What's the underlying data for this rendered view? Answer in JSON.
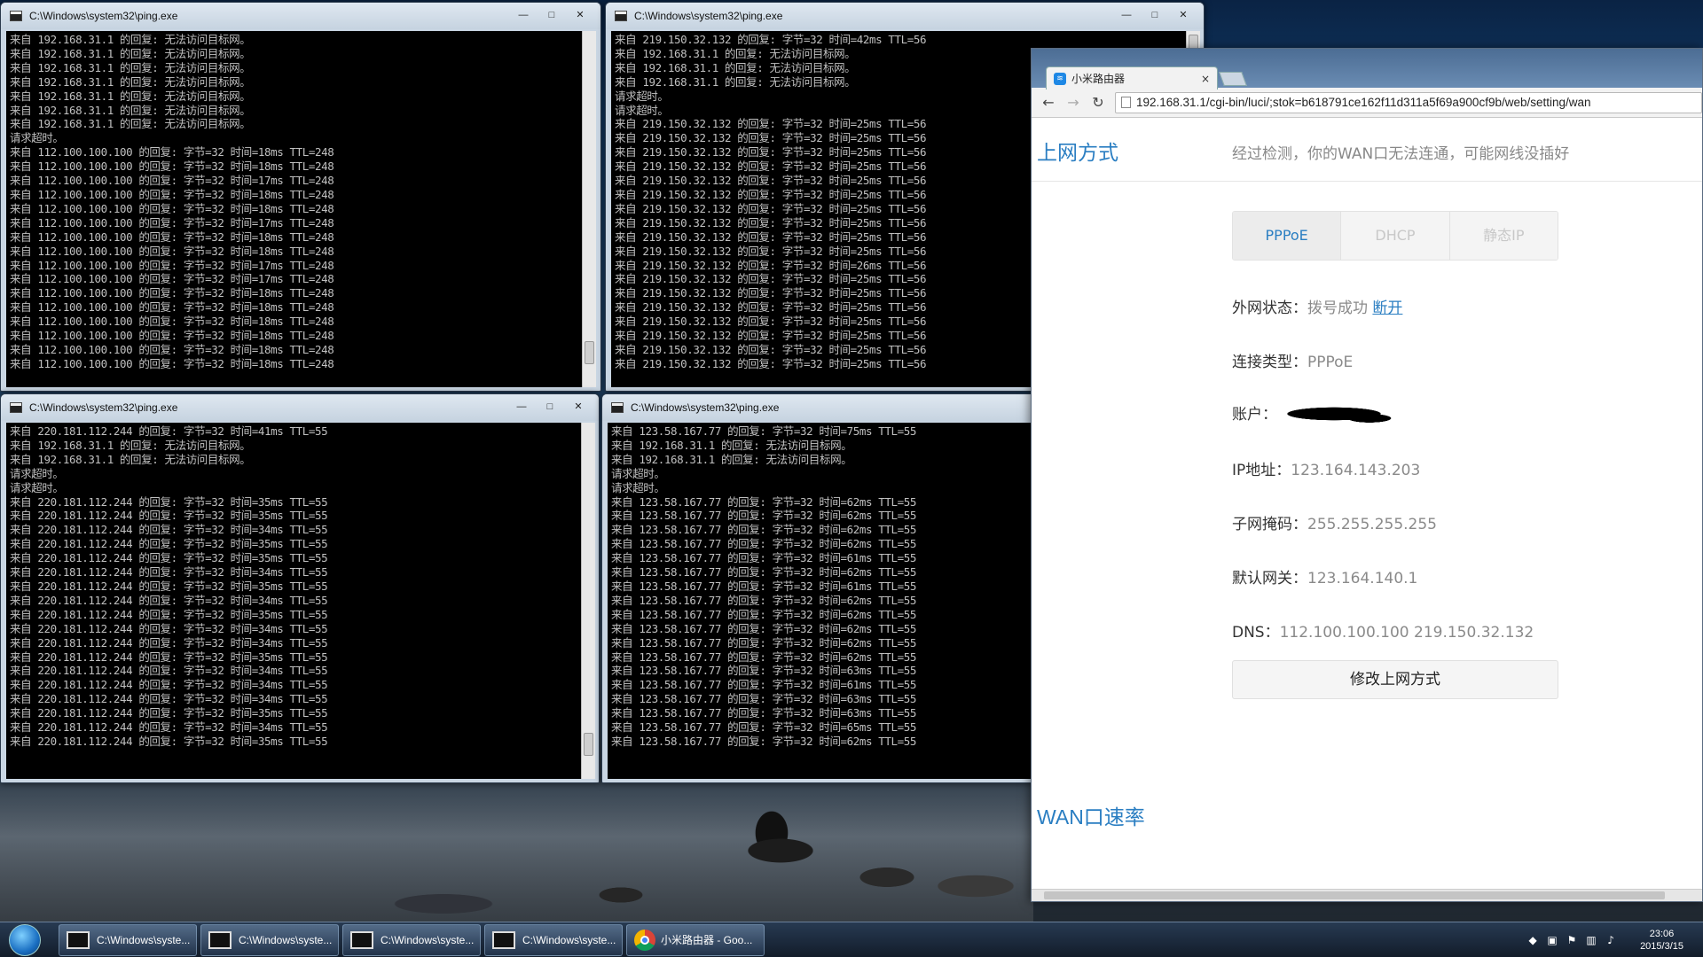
{
  "cmd_title": "C:\\Windows\\system32\\ping.exe",
  "window_controls": {
    "minimize": "—",
    "maximize": "□",
    "close": "✕"
  },
  "consoles": [
    {
      "id": "top-left",
      "lines": [
        "来自 192.168.31.1 的回复: 无法访问目标网。",
        "来自 192.168.31.1 的回复: 无法访问目标网。",
        "来自 192.168.31.1 的回复: 无法访问目标网。",
        "来自 192.168.31.1 的回复: 无法访问目标网。",
        "来自 192.168.31.1 的回复: 无法访问目标网。",
        "来自 192.168.31.1 的回复: 无法访问目标网。",
        "来自 192.168.31.1 的回复: 无法访问目标网。",
        "请求超时。",
        "来自 112.100.100.100 的回复: 字节=32 时间=18ms TTL=248",
        "来自 112.100.100.100 的回复: 字节=32 时间=18ms TTL=248",
        "来自 112.100.100.100 的回复: 字节=32 时间=17ms TTL=248",
        "来自 112.100.100.100 的回复: 字节=32 时间=18ms TTL=248",
        "来自 112.100.100.100 的回复: 字节=32 时间=18ms TTL=248",
        "来自 112.100.100.100 的回复: 字节=32 时间=17ms TTL=248",
        "来自 112.100.100.100 的回复: 字节=32 时间=18ms TTL=248",
        "来自 112.100.100.100 的回复: 字节=32 时间=18ms TTL=248",
        "来自 112.100.100.100 的回复: 字节=32 时间=17ms TTL=248",
        "来自 112.100.100.100 的回复: 字节=32 时间=17ms TTL=248",
        "来自 112.100.100.100 的回复: 字节=32 时间=18ms TTL=248",
        "来自 112.100.100.100 的回复: 字节=32 时间=18ms TTL=248",
        "来自 112.100.100.100 的回复: 字节=32 时间=18ms TTL=248",
        "来自 112.100.100.100 的回复: 字节=32 时间=18ms TTL=248",
        "来自 112.100.100.100 的回复: 字节=32 时间=18ms TTL=248",
        "来自 112.100.100.100 的回复: 字节=32 时间=18ms TTL=248"
      ]
    },
    {
      "id": "top-right",
      "lines": [
        "来自 219.150.32.132 的回复: 字节=32 时间=42ms TTL=56",
        "来自 192.168.31.1 的回复: 无法访问目标网。",
        "来自 192.168.31.1 的回复: 无法访问目标网。",
        "来自 192.168.31.1 的回复: 无法访问目标网。",
        "请求超时。",
        "请求超时。",
        "来自 219.150.32.132 的回复: 字节=32 时间=25ms TTL=56",
        "来自 219.150.32.132 的回复: 字节=32 时间=25ms TTL=56",
        "来自 219.150.32.132 的回复: 字节=32 时间=25ms TTL=56",
        "来自 219.150.32.132 的回复: 字节=32 时间=25ms TTL=56",
        "来自 219.150.32.132 的回复: 字节=32 时间=25ms TTL=56",
        "来自 219.150.32.132 的回复: 字节=32 时间=25ms TTL=56",
        "来自 219.150.32.132 的回复: 字节=32 时间=25ms TTL=56",
        "来自 219.150.32.132 的回复: 字节=32 时间=25ms TTL=56",
        "来自 219.150.32.132 的回复: 字节=32 时间=25ms TTL=56",
        "来自 219.150.32.132 的回复: 字节=32 时间=25ms TTL=56",
        "来自 219.150.32.132 的回复: 字节=32 时间=26ms TTL=56",
        "来自 219.150.32.132 的回复: 字节=32 时间=25ms TTL=56",
        "来自 219.150.32.132 的回复: 字节=32 时间=25ms TTL=56",
        "来自 219.150.32.132 的回复: 字节=32 时间=25ms TTL=56",
        "来自 219.150.32.132 的回复: 字节=32 时间=25ms TTL=56",
        "来自 219.150.32.132 的回复: 字节=32 时间=25ms TTL=56",
        "来自 219.150.32.132 的回复: 字节=32 时间=25ms TTL=56",
        "来自 219.150.32.132 的回复: 字节=32 时间=25ms TTL=56"
      ]
    },
    {
      "id": "bottom-left",
      "lines": [
        "来自 220.181.112.244 的回复: 字节=32 时间=41ms TTL=55",
        "来自 192.168.31.1 的回复: 无法访问目标网。",
        "来自 192.168.31.1 的回复: 无法访问目标网。",
        "请求超时。",
        "请求超时。",
        "来自 220.181.112.244 的回复: 字节=32 时间=35ms TTL=55",
        "来自 220.181.112.244 的回复: 字节=32 时间=35ms TTL=55",
        "来自 220.181.112.244 的回复: 字节=32 时间=34ms TTL=55",
        "来自 220.181.112.244 的回复: 字节=32 时间=35ms TTL=55",
        "来自 220.181.112.244 的回复: 字节=32 时间=35ms TTL=55",
        "来自 220.181.112.244 的回复: 字节=32 时间=34ms TTL=55",
        "来自 220.181.112.244 的回复: 字节=32 时间=35ms TTL=55",
        "来自 220.181.112.244 的回复: 字节=32 时间=34ms TTL=55",
        "来自 220.181.112.244 的回复: 字节=32 时间=35ms TTL=55",
        "来自 220.181.112.244 的回复: 字节=32 时间=34ms TTL=55",
        "来自 220.181.112.244 的回复: 字节=32 时间=34ms TTL=55",
        "来自 220.181.112.244 的回复: 字节=32 时间=35ms TTL=55",
        "来自 220.181.112.244 的回复: 字节=32 时间=34ms TTL=55",
        "来自 220.181.112.244 的回复: 字节=32 时间=34ms TTL=55",
        "来自 220.181.112.244 的回复: 字节=32 时间=34ms TTL=55",
        "来自 220.181.112.244 的回复: 字节=32 时间=35ms TTL=55",
        "来自 220.181.112.244 的回复: 字节=32 时间=34ms TTL=55",
        "来自 220.181.112.244 的回复: 字节=32 时间=35ms TTL=55"
      ]
    },
    {
      "id": "bottom-right",
      "lines": [
        "来自 123.58.167.77 的回复: 字节=32 时间=75ms TTL=55",
        "来自 192.168.31.1 的回复: 无法访问目标网。",
        "来自 192.168.31.1 的回复: 无法访问目标网。",
        "请求超时。",
        "请求超时。",
        "来自 123.58.167.77 的回复: 字节=32 时间=62ms TTL=55",
        "来自 123.58.167.77 的回复: 字节=32 时间=62ms TTL=55",
        "来自 123.58.167.77 的回复: 字节=32 时间=62ms TTL=55",
        "来自 123.58.167.77 的回复: 字节=32 时间=62ms TTL=55",
        "来自 123.58.167.77 的回复: 字节=32 时间=61ms TTL=55",
        "来自 123.58.167.77 的回复: 字节=32 时间=62ms TTL=55",
        "来自 123.58.167.77 的回复: 字节=32 时间=61ms TTL=55",
        "来自 123.58.167.77 的回复: 字节=32 时间=62ms TTL=55",
        "来自 123.58.167.77 的回复: 字节=32 时间=62ms TTL=55",
        "来自 123.58.167.77 的回复: 字节=32 时间=62ms TTL=55",
        "来自 123.58.167.77 的回复: 字节=32 时间=62ms TTL=55",
        "来自 123.58.167.77 的回复: 字节=32 时间=62ms TTL=55",
        "来自 123.58.167.77 的回复: 字节=32 时间=63ms TTL=55",
        "来自 123.58.167.77 的回复: 字节=32 时间=61ms TTL=55",
        "来自 123.58.167.77 的回复: 字节=32 时间=63ms TTL=55",
        "来自 123.58.167.77 的回复: 字节=32 时间=63ms TTL=55",
        "来自 123.58.167.77 的回复: 字节=32 时间=65ms TTL=55",
        "来自 123.58.167.77 的回复: 字节=32 时间=62ms TTL=55"
      ]
    }
  ],
  "browser": {
    "tab_title": "小米路由器",
    "tab_close": "×",
    "url": "192.168.31.1/cgi-bin/luci/;stok=b618791ce162f11d311a5f69a900cf9b/web/setting/wan",
    "nav": {
      "back": "←",
      "forward": "→",
      "reload": "↻"
    }
  },
  "page": {
    "section_title": "上网方式",
    "hint": "经过检测，你的WAN口无法连通，可能网线没插好",
    "tabs": [
      {
        "label": "PPPoE",
        "active": true
      },
      {
        "label": "DHCP",
        "active": false
      },
      {
        "label": "静态IP",
        "active": false
      }
    ],
    "fields": {
      "status_label": "外网状态：",
      "status_value": "拨号成功",
      "disconnect": "断开",
      "conn_type_label": "连接类型：",
      "conn_type_value": "PPPoE",
      "account_label": "账户：",
      "ip_label": "IP地址：",
      "ip_value": "123.164.143.203",
      "mask_label": "子网掩码：",
      "mask_value": "255.255.255.255",
      "gateway_label": "默认网关：",
      "gateway_value": "123.164.140.1",
      "dns_label": "DNS：",
      "dns_value": "112.100.100.100 219.150.32.132"
    },
    "modify_button": "修改上网方式",
    "wan_speed_title": "WAN口速率"
  },
  "taskbar": {
    "buttons": [
      {
        "label": "C:\\Windows\\syste..."
      },
      {
        "label": "C:\\Windows\\syste..."
      },
      {
        "label": "C:\\Windows\\syste..."
      },
      {
        "label": "C:\\Windows\\syste..."
      },
      {
        "label": "小米路由器 - Goo..."
      }
    ],
    "time": "23:06",
    "date": "2015/3/15"
  },
  "colors": {
    "accent": "#2a7ec2",
    "console_bg": "#000000",
    "console_text": "#c0c0c0"
  }
}
